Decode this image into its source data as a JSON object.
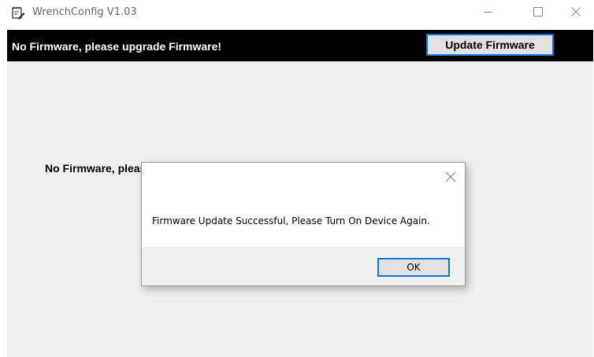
{
  "window": {
    "title": "WrenchConfig V1.03"
  },
  "banner": {
    "message": "No Firmware, please upgrade Firmware!",
    "update_button_label": "Update Firmware"
  },
  "main": {
    "message": "No Firmware, please upgrade Firmware!"
  },
  "dialog": {
    "message": "Firmware Update Successful, Please Turn On Device Again.",
    "ok_label": "OK"
  },
  "colors": {
    "banner_bg": "#000000",
    "banner_text": "#ffffff",
    "client_bg": "#f0f0f0",
    "focus_border": "#0078d7",
    "button_bg": "#e1e1e1"
  },
  "icons": {
    "app": "notepad-pen-icon",
    "minimize": "minimize-icon",
    "maximize": "maximize-icon",
    "close": "close-icon",
    "dialog_close": "close-icon"
  }
}
